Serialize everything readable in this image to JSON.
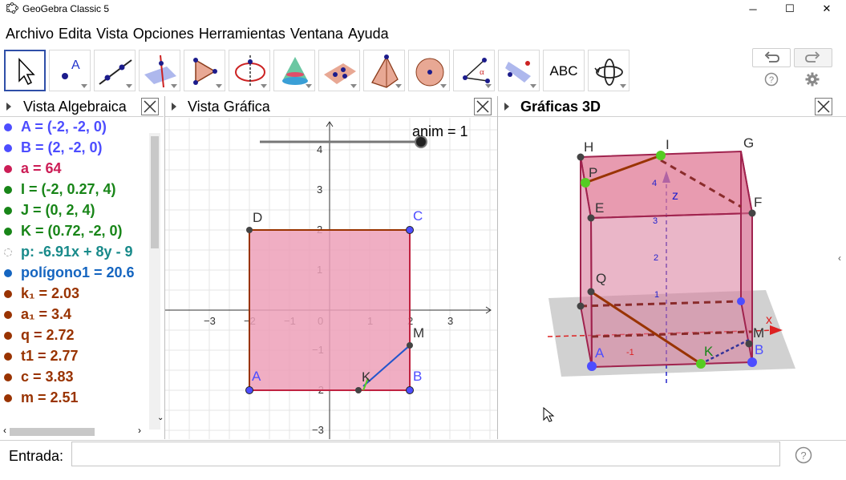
{
  "window": {
    "title": "GeoGebra Classic 5",
    "controls": [
      "─",
      "☐",
      "✕"
    ]
  },
  "menu": [
    "Archivo",
    "Edita",
    "Vista",
    "Opciones",
    "Herramientas",
    "Ventana",
    "Ayuda"
  ],
  "toolbar": {
    "tools": [
      {
        "name": "move-tool",
        "label": ""
      },
      {
        "name": "point-tool",
        "label": "A"
      },
      {
        "name": "line-tool",
        "label": ""
      },
      {
        "name": "perpendicular-tool",
        "label": ""
      },
      {
        "name": "polygon-tool",
        "label": ""
      },
      {
        "name": "circle-tool",
        "label": ""
      },
      {
        "name": "cone-tool",
        "label": ""
      },
      {
        "name": "plane-tool",
        "label": ""
      },
      {
        "name": "pyramid-tool",
        "label": ""
      },
      {
        "name": "sphere-tool",
        "label": ""
      },
      {
        "name": "angle-tool",
        "label": "α"
      },
      {
        "name": "reflect-tool",
        "label": ""
      },
      {
        "name": "text-tool",
        "label": "ABC"
      },
      {
        "name": "rotate-view-tool",
        "label": ""
      }
    ],
    "undo": "undo",
    "redo": "redo"
  },
  "algebra": {
    "title": "Vista Algebraica",
    "rows": [
      {
        "text": "A = (-2, -2, 0)",
        "color": "#4d4dff"
      },
      {
        "text": "B = (2, -2, 0)",
        "color": "#4d4dff"
      },
      {
        "text": "a = 64",
        "color": "#cc1d56"
      },
      {
        "text": "I = (-2, 0.27, 4)",
        "color": "#188518"
      },
      {
        "text": "J = (0, 2, 4)",
        "color": "#188518"
      },
      {
        "text": "K = (0.72, -2, 0)",
        "color": "#188518"
      },
      {
        "text": "p: -6.91x + 8y - 9",
        "color": "#188a8a"
      },
      {
        "text": "polígono1 = 20.6",
        "color": "#1565c0"
      },
      {
        "text": "k₁ = 2.03",
        "color": "#993300"
      },
      {
        "text": "a₁ = 3.4",
        "color": "#993300"
      },
      {
        "text": "q = 2.72",
        "color": "#993300"
      },
      {
        "text": "t1 = 2.77",
        "color": "#993300"
      },
      {
        "text": "c = 3.83",
        "color": "#993300"
      },
      {
        "text": "m = 2.51",
        "color": "#993300"
      }
    ]
  },
  "graphics": {
    "title": "Vista Gráfica",
    "slider_label": "anim = 1",
    "x_ticks": [
      "−3",
      "−2",
      "−1",
      "0",
      "1",
      "2",
      "3"
    ],
    "y_ticks": [
      "4",
      "3",
      "2",
      "1",
      "−1",
      "−2",
      "−3"
    ],
    "points": {
      "A": "A",
      "B": "B",
      "C": "C",
      "D": "D",
      "K": "K",
      "M": "M"
    }
  },
  "graphics3d": {
    "title": "Gráficas 3D",
    "labels": [
      "H",
      "I",
      "G",
      "P",
      "E",
      "F",
      "Q",
      "A",
      "K",
      "B",
      "M",
      "x",
      "z"
    ],
    "z_ticks": [
      "4",
      "3",
      "2",
      "1"
    ],
    "x_ticks": [
      "-1"
    ]
  },
  "input": {
    "label": "Entrada:",
    "value": ""
  },
  "colors": {
    "polygon_fill": "#eda0b8",
    "polygon_stroke": "#993300",
    "point_blue": "#4d4dff",
    "point_green": "#55cc22",
    "selected_tool": "#2f4fa8"
  }
}
